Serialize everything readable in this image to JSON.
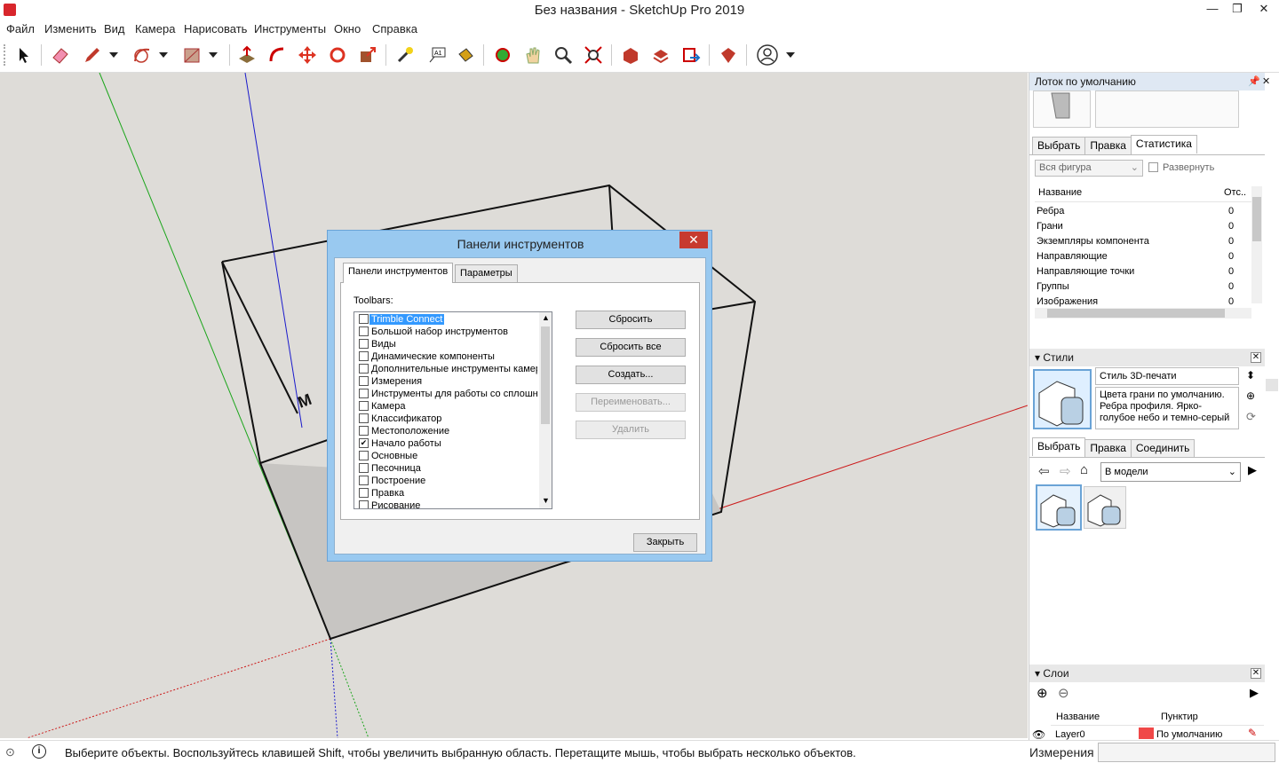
{
  "window": {
    "title": "Без названия - SketchUp Pro 2019",
    "min": "—",
    "max": "❐",
    "close": "✕"
  },
  "menu": [
    "Файл",
    "Изменить",
    "Вид",
    "Камера",
    "Нарисовать",
    "Инструменты",
    "Окно",
    "Справка"
  ],
  "status": {
    "text": "Выберите объекты. Воспользуйтесь клавишей Shift, чтобы увеличить выбранную область. Перетащите мышь, чтобы выбрать несколько объектов.",
    "measure_label": "Измерения"
  },
  "tray": {
    "title": "Лоток по умолчанию",
    "entity_tabs": [
      "Выбрать",
      "Правка",
      "Статистика"
    ],
    "stats_select": "Вся фигура",
    "expand_label": "Развернуть",
    "stats_header": {
      "name": "Название",
      "count": "Отс.."
    },
    "stats_rows": [
      {
        "name": "Ребра",
        "value": "0"
      },
      {
        "name": "Грани",
        "value": "0"
      },
      {
        "name": "Экземпляры компонента",
        "value": "0"
      },
      {
        "name": "Направляющие",
        "value": "0"
      },
      {
        "name": "Направляющие точки",
        "value": "0"
      },
      {
        "name": "Группы",
        "value": "0"
      },
      {
        "name": "Изображения",
        "value": "0"
      }
    ],
    "styles": {
      "title": "Стили",
      "style_name": "Стиль 3D-печати",
      "description": "Цвета грани по умолчанию. Ребра профиля. Ярко-голубое небо и темно-серый",
      "tabs": [
        "Выбрать",
        "Правка",
        "Соединить"
      ],
      "library": "В модели"
    },
    "layers": {
      "title": "Слои",
      "col_name": "Название",
      "col_dash": "Пунктир",
      "layer_name": "Layer0",
      "layer_dash": "По умолчанию",
      "layer_color": "#f04848"
    }
  },
  "dialog": {
    "title": "Панели инструментов",
    "tabs": [
      "Панели инструментов",
      "Параметры"
    ],
    "list_label": "Toolbars:",
    "items": [
      {
        "label": "Trimble Connect",
        "checked": false,
        "selected": true
      },
      {
        "label": "Большой набор инструментов",
        "checked": false
      },
      {
        "label": "Виды",
        "checked": false
      },
      {
        "label": "Динамические компоненты",
        "checked": false
      },
      {
        "label": "Дополнительные инструменты камеры",
        "checked": false
      },
      {
        "label": "Измерения",
        "checked": false
      },
      {
        "label": "Инструменты для работы со сплошными телами",
        "checked": false
      },
      {
        "label": "Камера",
        "checked": false
      },
      {
        "label": "Классификатор",
        "checked": false
      },
      {
        "label": "Местоположение",
        "checked": false
      },
      {
        "label": "Начало работы",
        "checked": true
      },
      {
        "label": "Основные",
        "checked": false
      },
      {
        "label": "Песочница",
        "checked": false
      },
      {
        "label": "Построение",
        "checked": false
      },
      {
        "label": "Правка",
        "checked": false
      },
      {
        "label": "Рисование",
        "checked": false
      }
    ],
    "buttons": {
      "reset": "Сбросить",
      "reset_all": "Сбросить все",
      "create": "Создать...",
      "rename": "Переименовать...",
      "delete": "Удалить",
      "close": "Закрыть"
    }
  }
}
